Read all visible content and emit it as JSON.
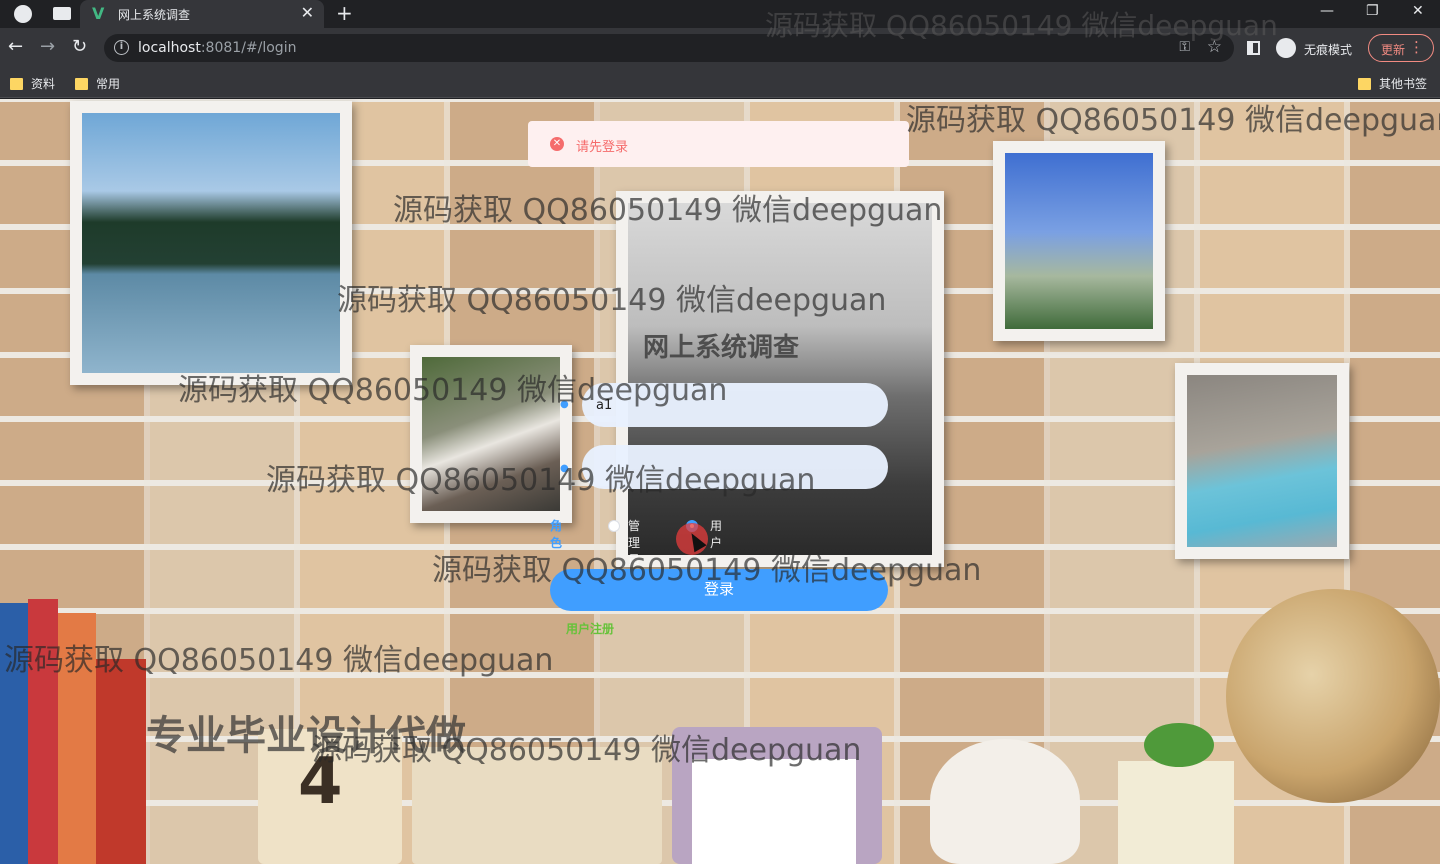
{
  "browser": {
    "tab_title": "网上系统调查",
    "tab_favicon": "V",
    "url_host": "localhost",
    "url_rest": ":8081/#/login",
    "incognito_label": "无痕模式",
    "update_label": "更新",
    "bookmarks": [
      "资料",
      "常用"
    ],
    "other_bookmarks": "其他书签"
  },
  "toast": {
    "message": "请先登录"
  },
  "form": {
    "title": "网上系统调查",
    "username_value": "a1",
    "password_value": "",
    "role_label": "角色",
    "roles": [
      "管理员",
      "用户"
    ],
    "login_label": "登录",
    "register_label": "用户注册"
  },
  "watermark_text": "源码获取 QQ86050149 微信deepguan",
  "promo_text": "专业毕业设计代做"
}
